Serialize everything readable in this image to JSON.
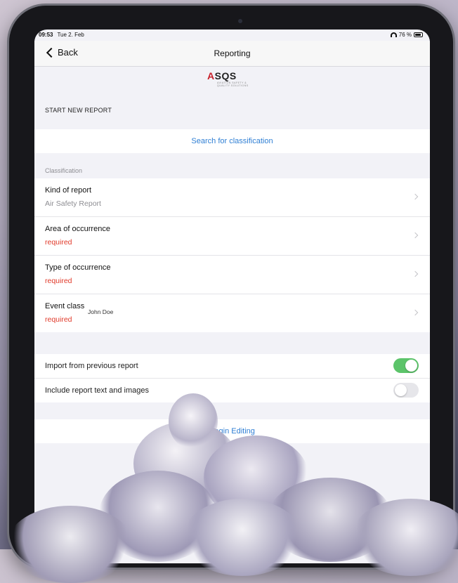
{
  "status_bar": {
    "time": "09:53",
    "date": "Tue 2. Feb",
    "battery": "76 %"
  },
  "nav": {
    "back_label": "Back",
    "title": "Reporting"
  },
  "logo": {
    "text_a": "A",
    "text_rest": "SQS",
    "tagline": "AVIATION SAFETY & QUALITY SOLUTIONS"
  },
  "start_label": "START NEW REPORT",
  "search_label": "Search for classification",
  "section_header": "Classification",
  "rows": [
    {
      "title": "Kind of report",
      "subtitle": "Air Safety Report"
    },
    {
      "title": "Area of occurrence",
      "subtitle": "required"
    },
    {
      "title": "Type of occurrence",
      "subtitle": "required"
    },
    {
      "title": "Event class",
      "subtitle": "required"
    }
  ],
  "overlay_name": "John Doe",
  "toggles": [
    {
      "label": "Import from previous report",
      "state": "on"
    },
    {
      "label": "Include report text and images",
      "state": "off"
    }
  ],
  "begin_editing": "Begin Editing",
  "colors": {
    "accent_blue": "#2f7fd4",
    "required_red": "#e03a2a",
    "toggle_green": "#5cc46a"
  }
}
